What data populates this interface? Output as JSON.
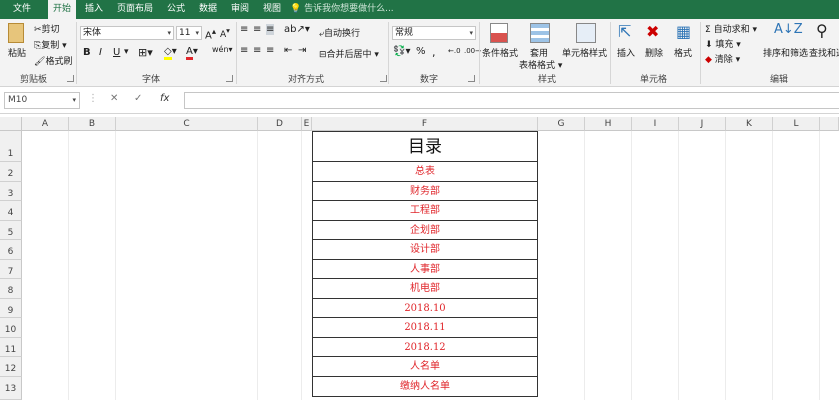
{
  "tabs": [
    "文件",
    "开始",
    "插入",
    "页面布局",
    "公式",
    "数据",
    "审阅",
    "视图"
  ],
  "tell_me": "告诉我你想要做什么...",
  "clipboard": {
    "paste": "粘贴",
    "cut": "剪切",
    "copy": "复制",
    "format_painter": "格式刷",
    "label": "剪贴板"
  },
  "font": {
    "name": "宋体",
    "size": "11",
    "label": "字体",
    "bold": "B",
    "italic": "I",
    "underline": "U"
  },
  "alignment": {
    "wrap": "自动换行",
    "merge": "合并后居中",
    "label": "对齐方式"
  },
  "number": {
    "format": "常规",
    "label": "数字",
    "percent": "%",
    "comma": ","
  },
  "styles": {
    "conditional": "条件格式",
    "table": "套用\n表格格式",
    "table_l1": "套用",
    "table_l2": "表格格式",
    "cell_styles": "单元格样式",
    "label": "样式"
  },
  "cells": {
    "insert": "插入",
    "delete": "删除",
    "format": "格式",
    "label": "单元格"
  },
  "editing": {
    "autosum": "自动求和",
    "fill": "填充",
    "clear": "清除",
    "sort": "排序和筛选",
    "find": "查找和选",
    "label": "编辑"
  },
  "formula_bar": {
    "name_box": "M10",
    "fx": "fx",
    "value": ""
  },
  "columns": [
    "A",
    "B",
    "C",
    "D",
    "E",
    "F",
    "G",
    "H",
    "I",
    "J",
    "K",
    "L"
  ],
  "rows": [
    "1",
    "2",
    "3",
    "4",
    "5",
    "6",
    "7",
    "8",
    "9",
    "10",
    "11",
    "12",
    "13"
  ],
  "sheet": {
    "title": "目录",
    "items": [
      "总表",
      "财务部",
      "工程部",
      "企划部",
      "设计部",
      "人事部",
      "机电部",
      "2018.10",
      "2018.11",
      "2018.12",
      "人名单",
      "缴纳人名单"
    ]
  },
  "colors": {
    "ribbon_green": "#217346",
    "link_red": "#e0262b"
  }
}
